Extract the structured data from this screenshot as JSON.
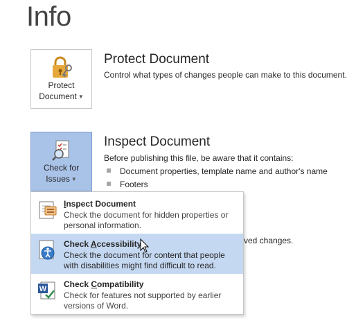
{
  "page": {
    "title": "Info"
  },
  "protect": {
    "button_line1": "Protect",
    "button_line2": "Document",
    "title": "Protect Document",
    "description": "Control what types of changes people can make to this document."
  },
  "inspect": {
    "button_line1": "Check for",
    "button_line2": "Issues",
    "title": "Inspect Document",
    "description": "Before publishing this file, be aware that it contains:",
    "bullets": [
      "Document properties, template name and author's name",
      "Footers"
    ],
    "partial_text": "ved changes."
  },
  "menu": {
    "items": [
      {
        "title": "Inspect Document",
        "access_key": "I",
        "description": "Check the document for hidden properties or personal information.",
        "icon": "inspect-document-icon"
      },
      {
        "title": "Check Accessibility",
        "access_key": "A",
        "description": "Check the document for content that people with disabilities might find difficult to read.",
        "icon": "accessibility-icon"
      },
      {
        "title": "Check Compatibility",
        "access_key": "C",
        "description": "Check for features not supported by earlier versions of Word.",
        "icon": "compatibility-icon"
      }
    ]
  },
  "colors": {
    "active_button": "#a9c3e8",
    "menu_hover": "#c5d8f1",
    "lock": "#e0a030",
    "word_blue": "#2b579a"
  }
}
